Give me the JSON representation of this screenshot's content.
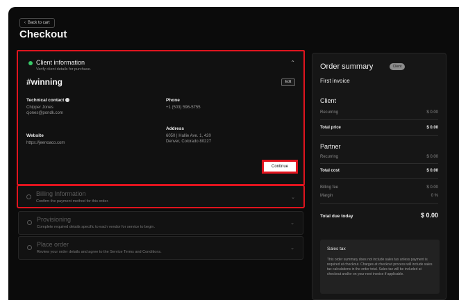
{
  "header": {
    "back_label": "Back to cart",
    "page_title": "Checkout"
  },
  "client_info": {
    "title": "Client information",
    "subtitle": "Verify client details for purchase.",
    "client_name": "#winning",
    "edit_label": "Edit",
    "technical_contact_label": "Technical contact",
    "contact_name": "Chipper Jones",
    "contact_email": "cjones@pondk.com",
    "phone_label": "Phone",
    "phone_value": "+1 (503) 596-5755",
    "website_label": "Website",
    "website_value": "https://jeenoaco.com",
    "address_label": "Address",
    "address_line1": "6050 | Hallie Ave. 1, 420",
    "address_line2": "Denver, Colorado 80227",
    "continue_label": "Continue"
  },
  "sections": [
    {
      "title": "Billing Information",
      "description": "Confirm the payment method for this order."
    },
    {
      "title": "Provisioning",
      "description": "Complete required details specific to each vendor for service to begin."
    },
    {
      "title": "Place order",
      "description": "Review your order details and agree to the Service Terms and Conditions."
    }
  ],
  "summary": {
    "title": "Order summary",
    "badge": "Client",
    "subtitle": "First invoice",
    "client_heading": "Client",
    "client_recurring_label": "Recurring",
    "client_recurring_value": "$ 0.00",
    "total_price_label": "Total price",
    "total_price_value": "$ 0.00",
    "partner_heading": "Partner",
    "partner_recurring_label": "Recurring",
    "partner_recurring_value": "$ 0.00",
    "total_cost_label": "Total cost",
    "total_cost_value": "$ 0.00",
    "billing_fee_label": "Billing fee",
    "billing_fee_value": "$ 0.00",
    "margin_label": "Margin",
    "margin_value": "0 %",
    "total_due_label": "Total due today",
    "total_due_value": "$ 0.00",
    "tax_title": "Sales tax",
    "tax_text": "This order summary does not include sales tax unless payment is required at checkout. Charges at checkout process will include sales tax calculations in the order total. Sales tax will be included at checkout and/or on your next invoice if applicable."
  },
  "colors": {
    "highlight_red": "#e0141e",
    "status_green": "#38c968",
    "background": "#0b0b0b"
  },
  "icons": [
    "chevron-left-icon",
    "status-dot-icon",
    "info-icon",
    "chevron-up-icon",
    "chevron-down-icon",
    "radio-icon"
  ]
}
